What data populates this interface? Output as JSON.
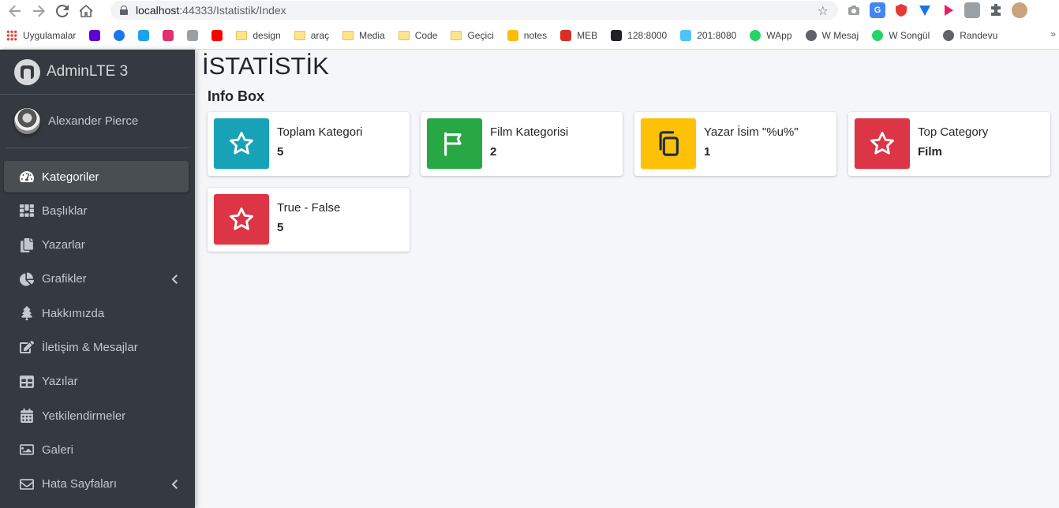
{
  "browser": {
    "url_host": "localhost",
    "url_path": ":44333/Istatistik/Index",
    "bookmarks": [
      {
        "label": "Uygulamalar",
        "icon": "apps-grid-icon",
        "color": "#ea4335"
      },
      {
        "label": "",
        "icon": "mail-icon",
        "color": "#6001d2"
      },
      {
        "label": "",
        "icon": "facebook-icon",
        "color": "#1877f2"
      },
      {
        "label": "",
        "icon": "twitter-icon",
        "color": "#1da1f2"
      },
      {
        "label": "",
        "icon": "instagram-icon",
        "color": "#e1306c"
      },
      {
        "label": "",
        "icon": "signal-icon",
        "color": "#9aa0a6"
      },
      {
        "label": "",
        "icon": "youtube-icon",
        "color": "#ff0000"
      },
      {
        "label": "design",
        "icon": "folder-icon",
        "color": "#fce58a"
      },
      {
        "label": "araç",
        "icon": "folder-icon",
        "color": "#fce58a"
      },
      {
        "label": "Media",
        "icon": "folder-icon",
        "color": "#fce58a"
      },
      {
        "label": "Code",
        "icon": "folder-icon",
        "color": "#fce58a"
      },
      {
        "label": "Geçici",
        "icon": "folder-icon",
        "color": "#fce58a"
      },
      {
        "label": "notes",
        "icon": "notes-icon",
        "color": "#fbbc04"
      },
      {
        "label": "MEB",
        "icon": "meb-icon",
        "color": "#d93025"
      },
      {
        "label": "128:8000",
        "icon": "router-icon",
        "color": "#202124"
      },
      {
        "label": "201:8080",
        "icon": "wifi-icon",
        "color": "#4fc3f7"
      },
      {
        "label": "WApp",
        "icon": "whatsapp-icon",
        "color": "#25d366"
      },
      {
        "label": "W Mesaj",
        "icon": "globe-icon",
        "color": "#5f6368"
      },
      {
        "label": "W Songül",
        "icon": "whatsapp-icon",
        "color": "#25d366"
      },
      {
        "label": "Randevu",
        "icon": "globe-icon",
        "color": "#5f6368"
      }
    ],
    "more_label": "»"
  },
  "sidebar": {
    "brand": "AdminLTE 3",
    "user": "Alexander Pierce",
    "items": [
      {
        "label": "Kategoriler",
        "icon": "tachometer-icon",
        "active": true,
        "chevron": false
      },
      {
        "label": "Başlıklar",
        "icon": "th-grid-icon",
        "active": false,
        "chevron": false
      },
      {
        "label": "Yazarlar",
        "icon": "copy-icon",
        "active": false,
        "chevron": false
      },
      {
        "label": "Grafikler",
        "icon": "pie-chart-icon",
        "active": false,
        "chevron": true
      },
      {
        "label": "Hakkımızda",
        "icon": "tree-icon",
        "active": false,
        "chevron": false
      },
      {
        "label": "İletişim & Mesajlar",
        "icon": "edit-icon",
        "active": false,
        "chevron": false
      },
      {
        "label": "Yazılar",
        "icon": "table-icon",
        "active": false,
        "chevron": false
      },
      {
        "label": "Yetkilendirmeler",
        "icon": "calendar-icon",
        "active": false,
        "chevron": false
      },
      {
        "label": "Galeri",
        "icon": "image-icon",
        "active": false,
        "chevron": false
      },
      {
        "label": "Hata Sayfaları",
        "icon": "envelope-icon",
        "active": false,
        "chevron": true
      }
    ]
  },
  "main": {
    "title": "İSTATİSTİK",
    "section_title": "Info Box",
    "boxes": [
      {
        "label": "Toplam Kategori",
        "value": "5",
        "icon": "star-icon",
        "color": "#17a2b8",
        "icon_color": "#ffffff"
      },
      {
        "label": "Film Kategorisi",
        "value": "2",
        "icon": "flag-icon",
        "color": "#28a745",
        "icon_color": "#ffffff"
      },
      {
        "label": "Yazar İsim \"%u%\"",
        "value": "1",
        "icon": "copy-icon",
        "color": "#ffc107",
        "icon_color": "#1f2d3d"
      },
      {
        "label": "Top Category",
        "value": "Film",
        "icon": "star-icon",
        "color": "#dc3545",
        "icon_color": "#ffffff"
      },
      {
        "label": "True - False",
        "value": "5",
        "icon": "star-icon",
        "color": "#dc3545",
        "icon_color": "#ffffff"
      }
    ]
  }
}
